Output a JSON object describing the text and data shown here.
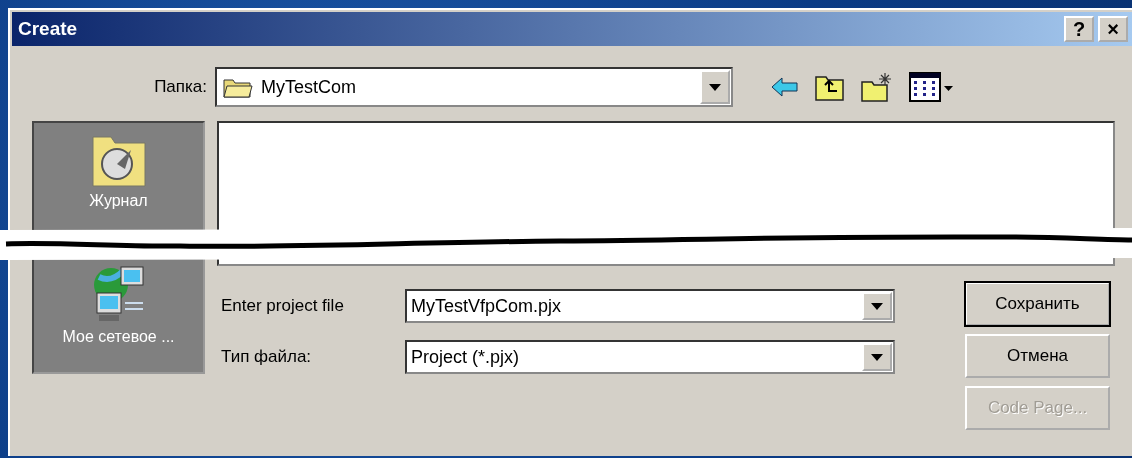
{
  "window": {
    "title": "Create",
    "title_buttons": [
      {
        "kind": "help",
        "label": "?"
      },
      {
        "kind": "close",
        "label": "×"
      }
    ]
  },
  "folder": {
    "label": "Папка:",
    "value": "MyTestCom"
  },
  "toolbar": [
    {
      "kind": "back"
    },
    {
      "kind": "up"
    },
    {
      "kind": "new-folder"
    },
    {
      "kind": "view-menu"
    }
  ],
  "places": [
    {
      "kind": "history",
      "label": "Журнал"
    },
    {
      "kind": "network",
      "label": "Мое сетевое ..."
    }
  ],
  "file_name": {
    "label": "Enter project file",
    "value": "MyTestVfpCom.pjx"
  },
  "file_type": {
    "label": "Тип файла:",
    "value": "Project (*.pjx)"
  },
  "buttons": [
    {
      "label": "Сохранить",
      "default": true,
      "disabled": false
    },
    {
      "label": "Отмена",
      "default": false,
      "disabled": false
    },
    {
      "label": "Code Page...",
      "default": false,
      "disabled": true
    }
  ]
}
